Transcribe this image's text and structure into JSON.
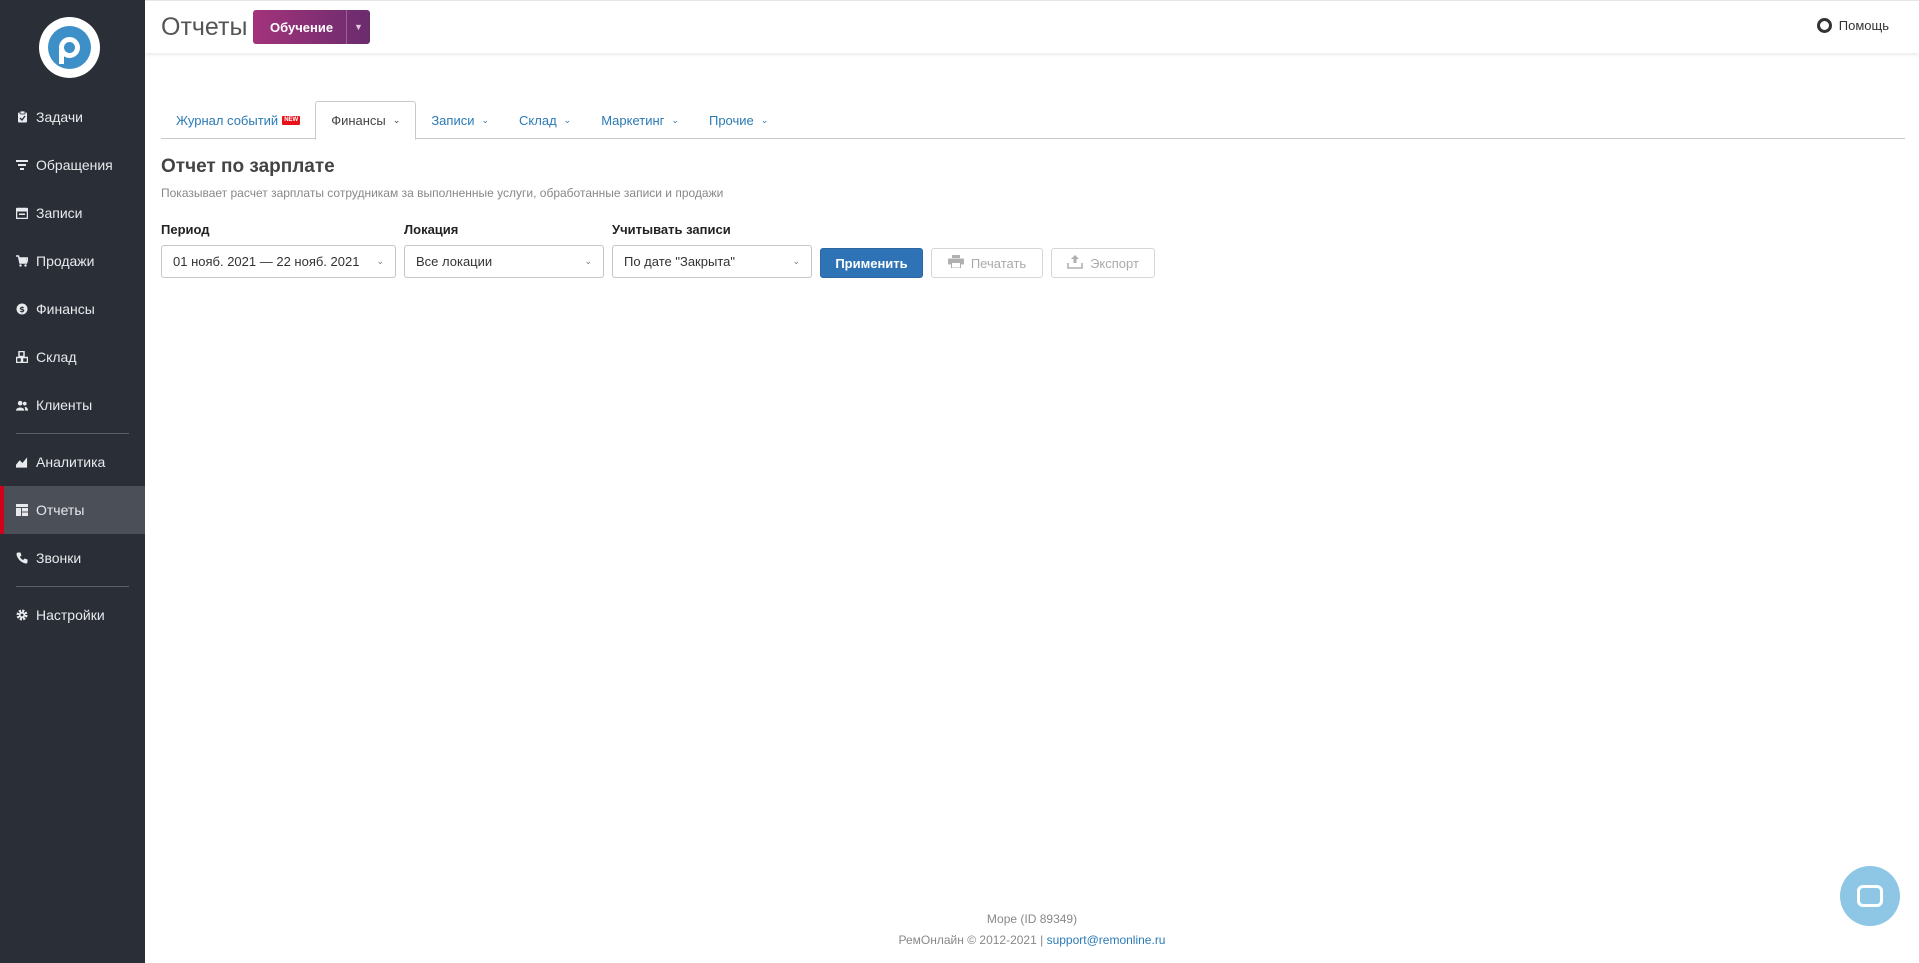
{
  "sidebar": {
    "items": [
      {
        "label": "Задачи",
        "icon": "clipboard-icon"
      },
      {
        "label": "Обращения",
        "icon": "filter-icon"
      },
      {
        "label": "Записи",
        "icon": "calendar-icon"
      },
      {
        "label": "Продажи",
        "icon": "cart-icon"
      },
      {
        "label": "Финансы",
        "icon": "coin-icon"
      },
      {
        "label": "Склад",
        "icon": "boxes-icon"
      },
      {
        "label": "Клиенты",
        "icon": "users-icon"
      },
      {
        "label": "Аналитика",
        "icon": "chart-icon"
      },
      {
        "label": "Отчеты",
        "icon": "table-icon"
      },
      {
        "label": "Звонки",
        "icon": "phone-icon"
      },
      {
        "label": "Настройки",
        "icon": "gear-icon"
      }
    ],
    "active_index": 8,
    "active_color": "#d0021b"
  },
  "header": {
    "title": "Отчеты",
    "training_label": "Обучение",
    "help_label": "Помощь"
  },
  "tabs": [
    {
      "label": "Журнал событий",
      "badge": "NEW",
      "has_dropdown": false
    },
    {
      "label": "Финансы",
      "has_dropdown": true,
      "active": true
    },
    {
      "label": "Записи",
      "has_dropdown": true
    },
    {
      "label": "Склад",
      "has_dropdown": true
    },
    {
      "label": "Маркетинг",
      "has_dropdown": true
    },
    {
      "label": "Прочие",
      "has_dropdown": true
    }
  ],
  "report": {
    "title": "Отчет по зарплате",
    "description": "Показывает расчет зарплаты сотрудникам за выполненные услуги, обработанные записи и продажи"
  },
  "filters": {
    "period_label": "Период",
    "period_value": "01 нояб. 2021 — 22 нояб. 2021",
    "location_label": "Локация",
    "location_value": "Все локации",
    "records_label": "Учитывать записи",
    "records_value": "По дате \"Закрыта\""
  },
  "actions": {
    "apply_label": "Применить",
    "print_label": "Печатать",
    "export_label": "Экспорт"
  },
  "footer": {
    "account": "Море (ID 89349)",
    "copyright": "РемОнлайн © 2012-2021 |",
    "support_email": "support@remonline.ru"
  },
  "colors": {
    "sidebar_bg": "#2a2e36",
    "accent_blue": "#2e73b5",
    "training_gradient_start": "#a3337b",
    "training_gradient_end": "#6a2c6e"
  }
}
